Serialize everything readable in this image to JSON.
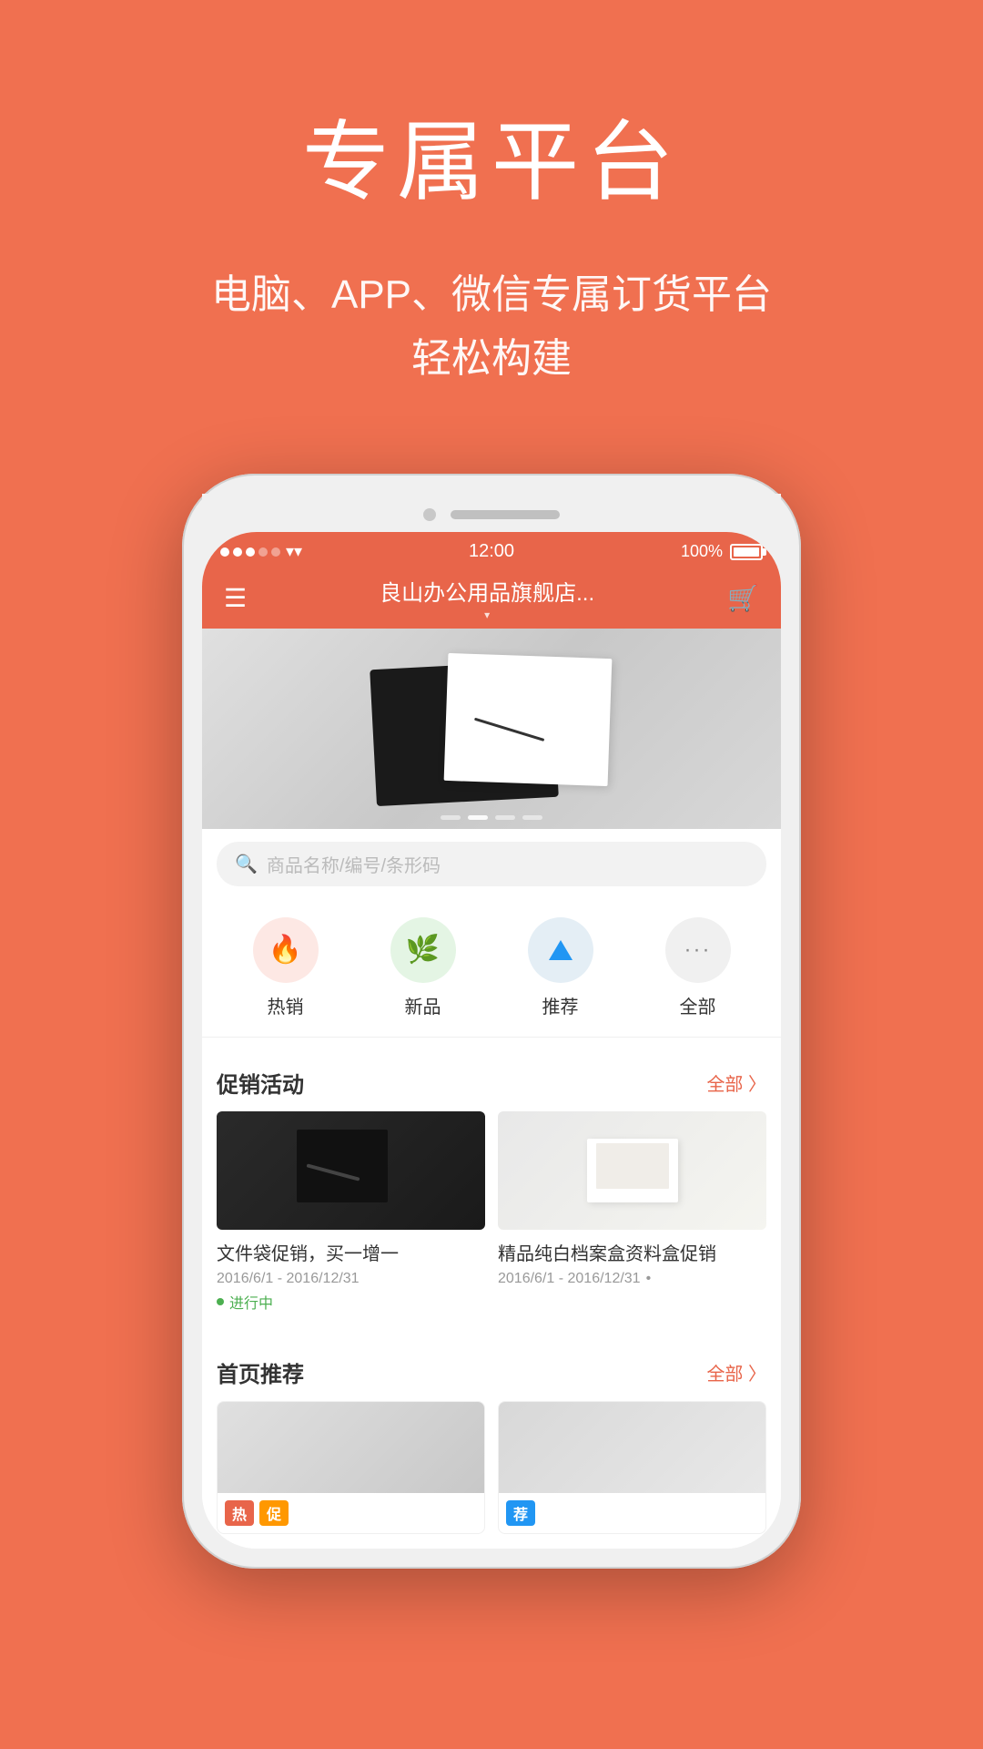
{
  "hero": {
    "title": "专属平台",
    "subtitle_line1": "电脑、APP、微信专属订货平台",
    "subtitle_line2": "轻松构建"
  },
  "phone": {
    "status_bar": {
      "time": "12:00",
      "battery": "100%"
    },
    "nav": {
      "title": "良山办公用品旗舰店...",
      "chevron": "▾"
    },
    "search": {
      "placeholder": "商品名称/编号/条形码"
    },
    "categories": [
      {
        "id": "hot",
        "label": "热销",
        "icon": "🔥"
      },
      {
        "id": "new",
        "label": "新品",
        "icon": "🌿"
      },
      {
        "id": "rec",
        "label": "推荐",
        "icon": "▲"
      },
      {
        "id": "all",
        "label": "全部",
        "icon": "···"
      }
    ],
    "promotions": {
      "section_title": "促销活动",
      "more_label": "全部 〉",
      "items": [
        {
          "title": "文件袋促销，买一增一",
          "date": "2016/6/1 - 2016/12/31",
          "status": "进行中"
        },
        {
          "title": "精品纯白档案盒资料盒促销",
          "date": "2016/6/1 - 2016/12/31",
          "status": "•"
        }
      ]
    },
    "featured": {
      "section_title": "首页推荐",
      "more_label": "全部 〉",
      "badges": [
        "热",
        "促",
        "荐"
      ]
    }
  }
}
